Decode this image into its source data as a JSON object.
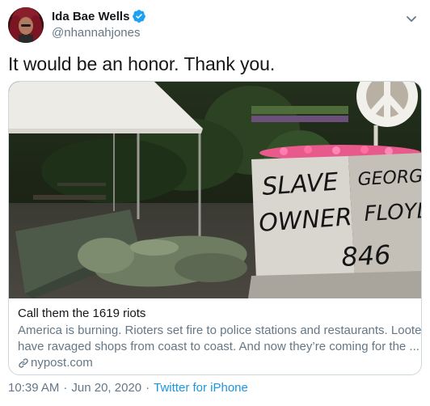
{
  "user": {
    "display_name": "Ida Bae Wells",
    "handle": "@nhannahjones"
  },
  "tweet": {
    "text": "It would be an honor. Thank you."
  },
  "card": {
    "title": "Call them the 1619 riots",
    "description_line1": "America is burning. Rioters set fire to police stations and restaurants. Looters",
    "description_line2": "have ravaged shops from coast to coast. And now they’re coming for the ...",
    "domain": "nypost.com",
    "image_graffiti": [
      "SLAVE",
      "OWNER",
      "GEORGE",
      "FLOYD",
      "846"
    ]
  },
  "meta": {
    "time": "10:39 AM",
    "separator": "·",
    "date": "Jun 20, 2020",
    "source": "Twitter for iPhone"
  },
  "icons": {
    "verified": "verified-badge-icon",
    "menu": "chevron-down-icon",
    "link": "link-icon"
  },
  "colors": {
    "text_primary": "#14171a",
    "text_secondary": "#657786",
    "link_blue": "#1b95e0",
    "verified_blue": "#1da1f2",
    "border": "#ccd6dd"
  }
}
